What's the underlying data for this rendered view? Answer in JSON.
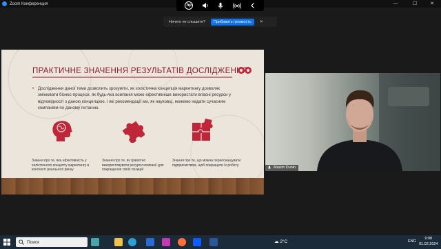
{
  "window": {
    "title": "Zoom Конференция",
    "controls": [
      "—",
      "☐",
      "✕"
    ]
  },
  "audio_overlay": {
    "logo": "hp",
    "icons": [
      "speaker-icon",
      "microphone-icon",
      "broadcast-icon",
      "chevron-left-icon"
    ]
  },
  "notification": {
    "text": "Ничего не слышите?",
    "button_label": "Прибавить громкость",
    "close_label": "✕",
    "button_color": "#0e72ed"
  },
  "slide": {
    "title": "ПРАКТИЧНЕ ЗНАЧЕННЯ РЕЗУЛЬТАТІВ ДОСЛІДЖЕННЯ",
    "bullet": "Дослідження даної теми дозволить зрозуміти, як холістична концепція маркетингу дозволяє змінювати бізнес-процеси, як будь-яка компанія може ефективніше використати власні ресурси у відповідності з даною концепцією, і які рекомендації ми, як науковці, можемо надати сучасним компаніям по даному питанню.",
    "accent_color": "#8b1a2b",
    "columns": [
      {
        "icon": "brain-head-icon",
        "caption": "Знання про те, яка ефективність у холістичного концепту маркетингу в контексті реального ринку"
      },
      {
        "icon": "puzzle-piece-icon",
        "caption": "Знання про те, як грамотно використовувати ресурси компанії для покращення своїх позицій"
      },
      {
        "icon": "puzzle-square-icon",
        "caption": "Знання про те, що можна переоснащувати підприємством, щоб покращити їх роботу"
      }
    ]
  },
  "participant": {
    "name": "Maxim Dunin"
  },
  "taskbar": {
    "search_label": "Поиск",
    "weather": "2°C",
    "language": "ENG",
    "time": "9:08",
    "date": "01.02.2024"
  }
}
